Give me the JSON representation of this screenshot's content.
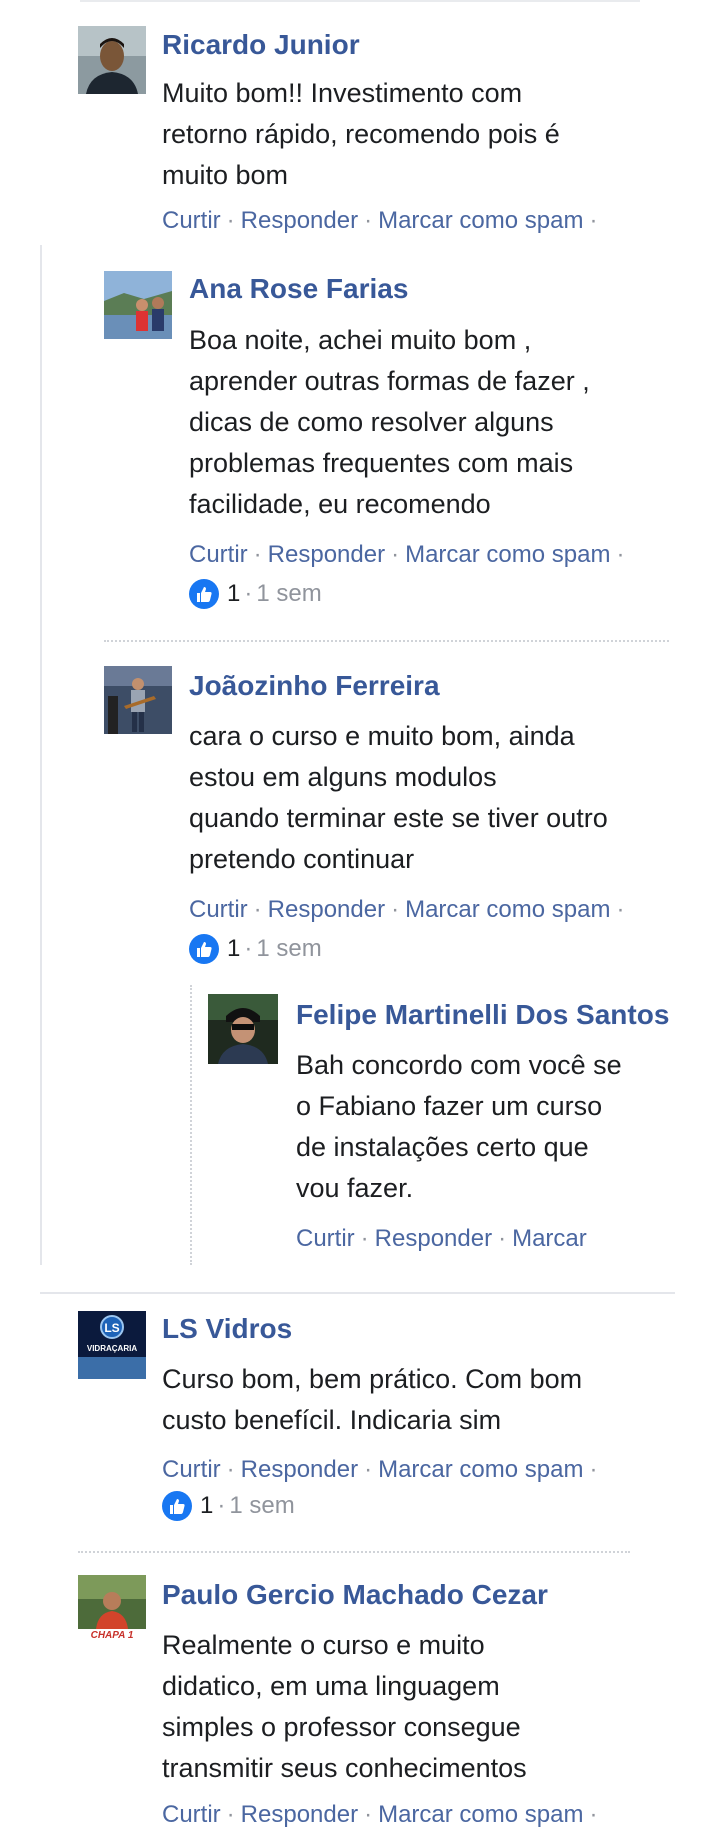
{
  "actions": {
    "like": "Curtir",
    "reply": "Responder",
    "spam": "Marcar como spam",
    "sep": "·"
  },
  "comments": [
    {
      "author": "Ricardo Junior",
      "lines": [
        "Muito bom!! Investimento com",
        "retorno rápido, recomendo pois é",
        "muito bom"
      ],
      "actions_suffix": "·"
    },
    {
      "author": "Ana Rose Farias",
      "lines": [
        "Boa noite, achei muito bom ,",
        "aprender outras formas de fazer ,",
        "dicas de como resolver alguns",
        "problemas frequentes com mais",
        "facilidade, eu recomendo"
      ],
      "actions_suffix": "·",
      "likes": "1",
      "time": "1 sem"
    },
    {
      "author": "Joãozinho Ferreira",
      "lines": [
        "cara o curso e muito bom, ainda",
        "estou em alguns modulos",
        "quando terminar este se tiver outro",
        "pretendo continuar"
      ],
      "actions_suffix": "·",
      "likes": "1",
      "time": "1 sem"
    },
    {
      "author": "Felipe Martinelli Dos Santos",
      "lines": [
        "Bah concordo com você se",
        "o Fabiano fazer um curso",
        "de instalações certo que",
        "vou fazer."
      ],
      "actions_short": "Marcar"
    },
    {
      "author": "LS Vidros",
      "avatar_text": "VIDRAÇARIA",
      "lines": [
        "Curso bom, bem prático. Com bom",
        "custo benefícil. Indicaria sim"
      ],
      "actions_suffix": "·",
      "likes": "1",
      "time": "1 sem"
    },
    {
      "author": "Paulo Gercio Machado Cezar",
      "avatar_text": "CHAPA 1",
      "lines": [
        "Realmente o curso e muito",
        "didatico, em uma linguagem",
        "simples o professor consegue",
        "transmitir seus conhecimentos"
      ],
      "actions_suffix": "·"
    }
  ],
  "colors": {
    "name": "#385898",
    "action": "#4b67a1",
    "like_badge": "#1877f2",
    "meta": "#90949c"
  },
  "icons": [
    "like-thumb-icon"
  ]
}
